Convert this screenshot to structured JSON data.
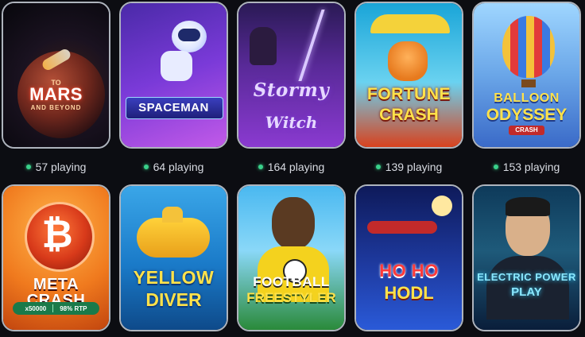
{
  "games": [
    {
      "title_lines": [
        "TO",
        "MARS",
        "AND BEYOND"
      ],
      "players": "57 playing",
      "accent": "#e63a2a"
    },
    {
      "title_lines": [
        "SPACEMAN"
      ],
      "players": "64 playing",
      "accent": "#7a3ad8"
    },
    {
      "title_lines": [
        "Stormy",
        "Witch"
      ],
      "players": "164 playing",
      "accent": "#8a3ad0"
    },
    {
      "title_lines": [
        "FORTUNE",
        "CRASH"
      ],
      "players": "139 playing",
      "accent": "#ffe24a"
    },
    {
      "title_lines": [
        "BALLOON",
        "ODYSSEY",
        "CRASH"
      ],
      "players": "153 playing",
      "accent": "#ffe24a"
    },
    {
      "title_lines": [
        "META CRASH"
      ],
      "badge_left": "x50000",
      "badge_right": "98% RTP",
      "players": "",
      "accent": "#f07a1e"
    },
    {
      "title_lines": [
        "YELLOW",
        "DIVER"
      ],
      "players": "",
      "accent": "#ffe24a"
    },
    {
      "title_lines": [
        "FOOTBALL",
        "FREESTYLER"
      ],
      "players": "",
      "accent": "#f4d21e"
    },
    {
      "title_lines": [
        "HO HO",
        "HODL"
      ],
      "players": "",
      "accent": "#ff3a3a"
    },
    {
      "title_lines": [
        "ELECTRIC POWER",
        "PLAY"
      ],
      "players": "",
      "accent": "#8ae8ff"
    }
  ],
  "colors": {
    "background": "#0c0d12",
    "card_border": "#aeb4bd",
    "online_dot": "#39d08a",
    "player_text": "#d8dbe2"
  },
  "icons": [
    "online-dot-icon",
    "bitcoin-icon"
  ]
}
